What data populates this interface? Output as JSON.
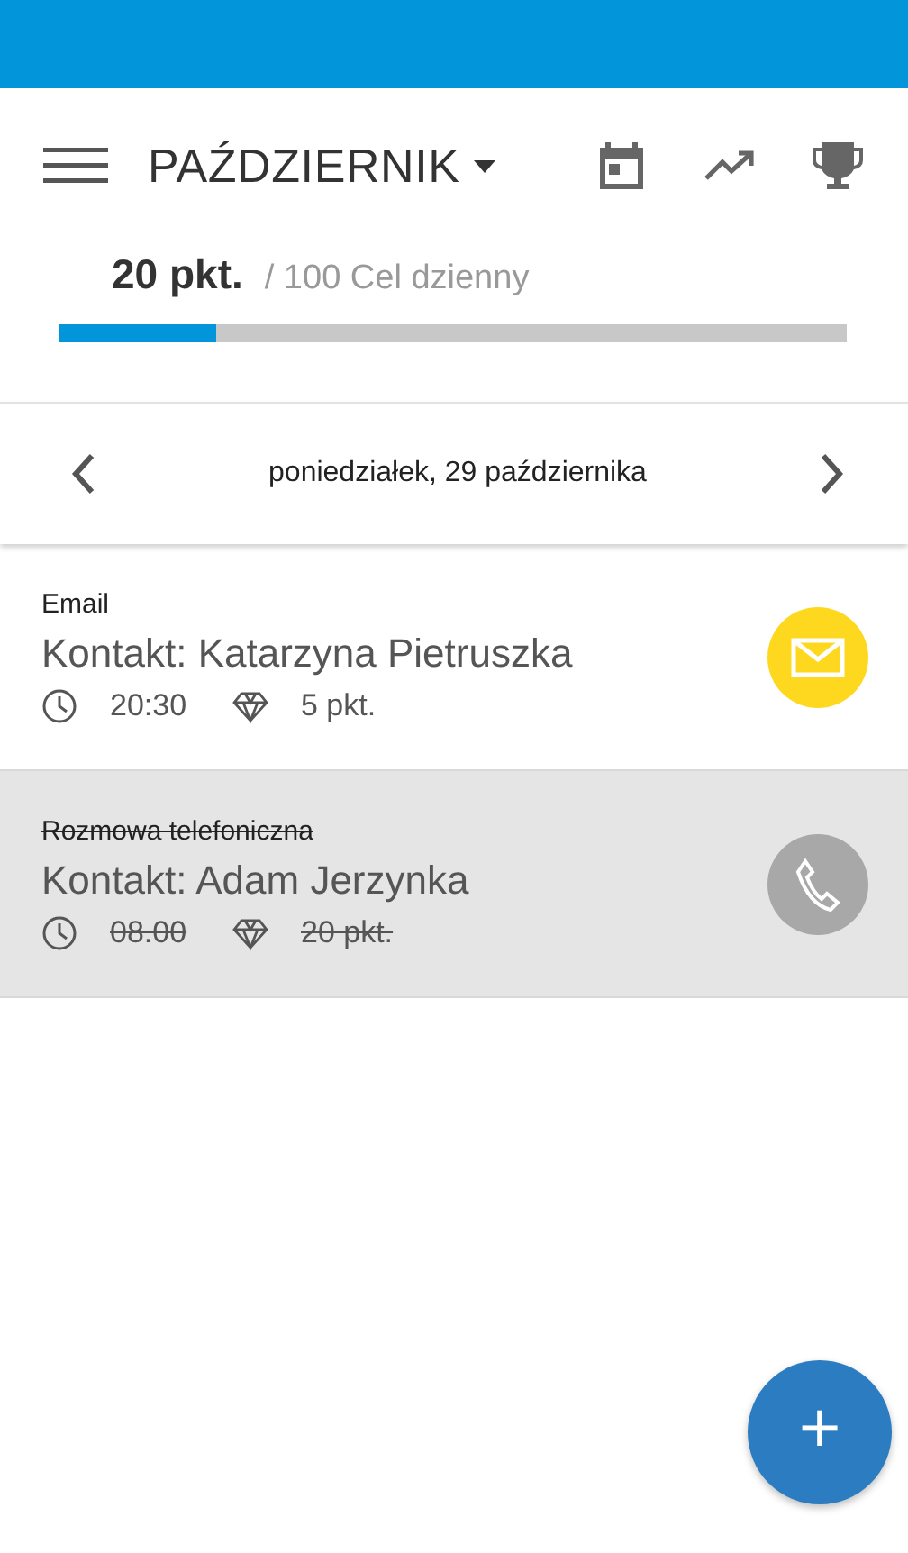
{
  "header": {
    "month": "PAŹDZIERNIK"
  },
  "goal": {
    "points": "20 pkt.",
    "target": "/ 100 Cel dzienny",
    "level": 0.2
  },
  "day_nav": {
    "date": "poniedziałek, 29 października"
  },
  "tasks": [
    {
      "kind": "email",
      "type_label": "Email",
      "contact": "Kontakt: Katarzyna Pietruszka",
      "time": "20:30",
      "points": "5 pkt.",
      "done": false
    },
    {
      "kind": "phone",
      "type_label": "Rozmowa telefoniczna",
      "contact": "Kontakt: Adam Jerzynka",
      "time": "08.00",
      "points": "20 pkt.",
      "done": true
    }
  ],
  "fab": {
    "label": "+"
  }
}
